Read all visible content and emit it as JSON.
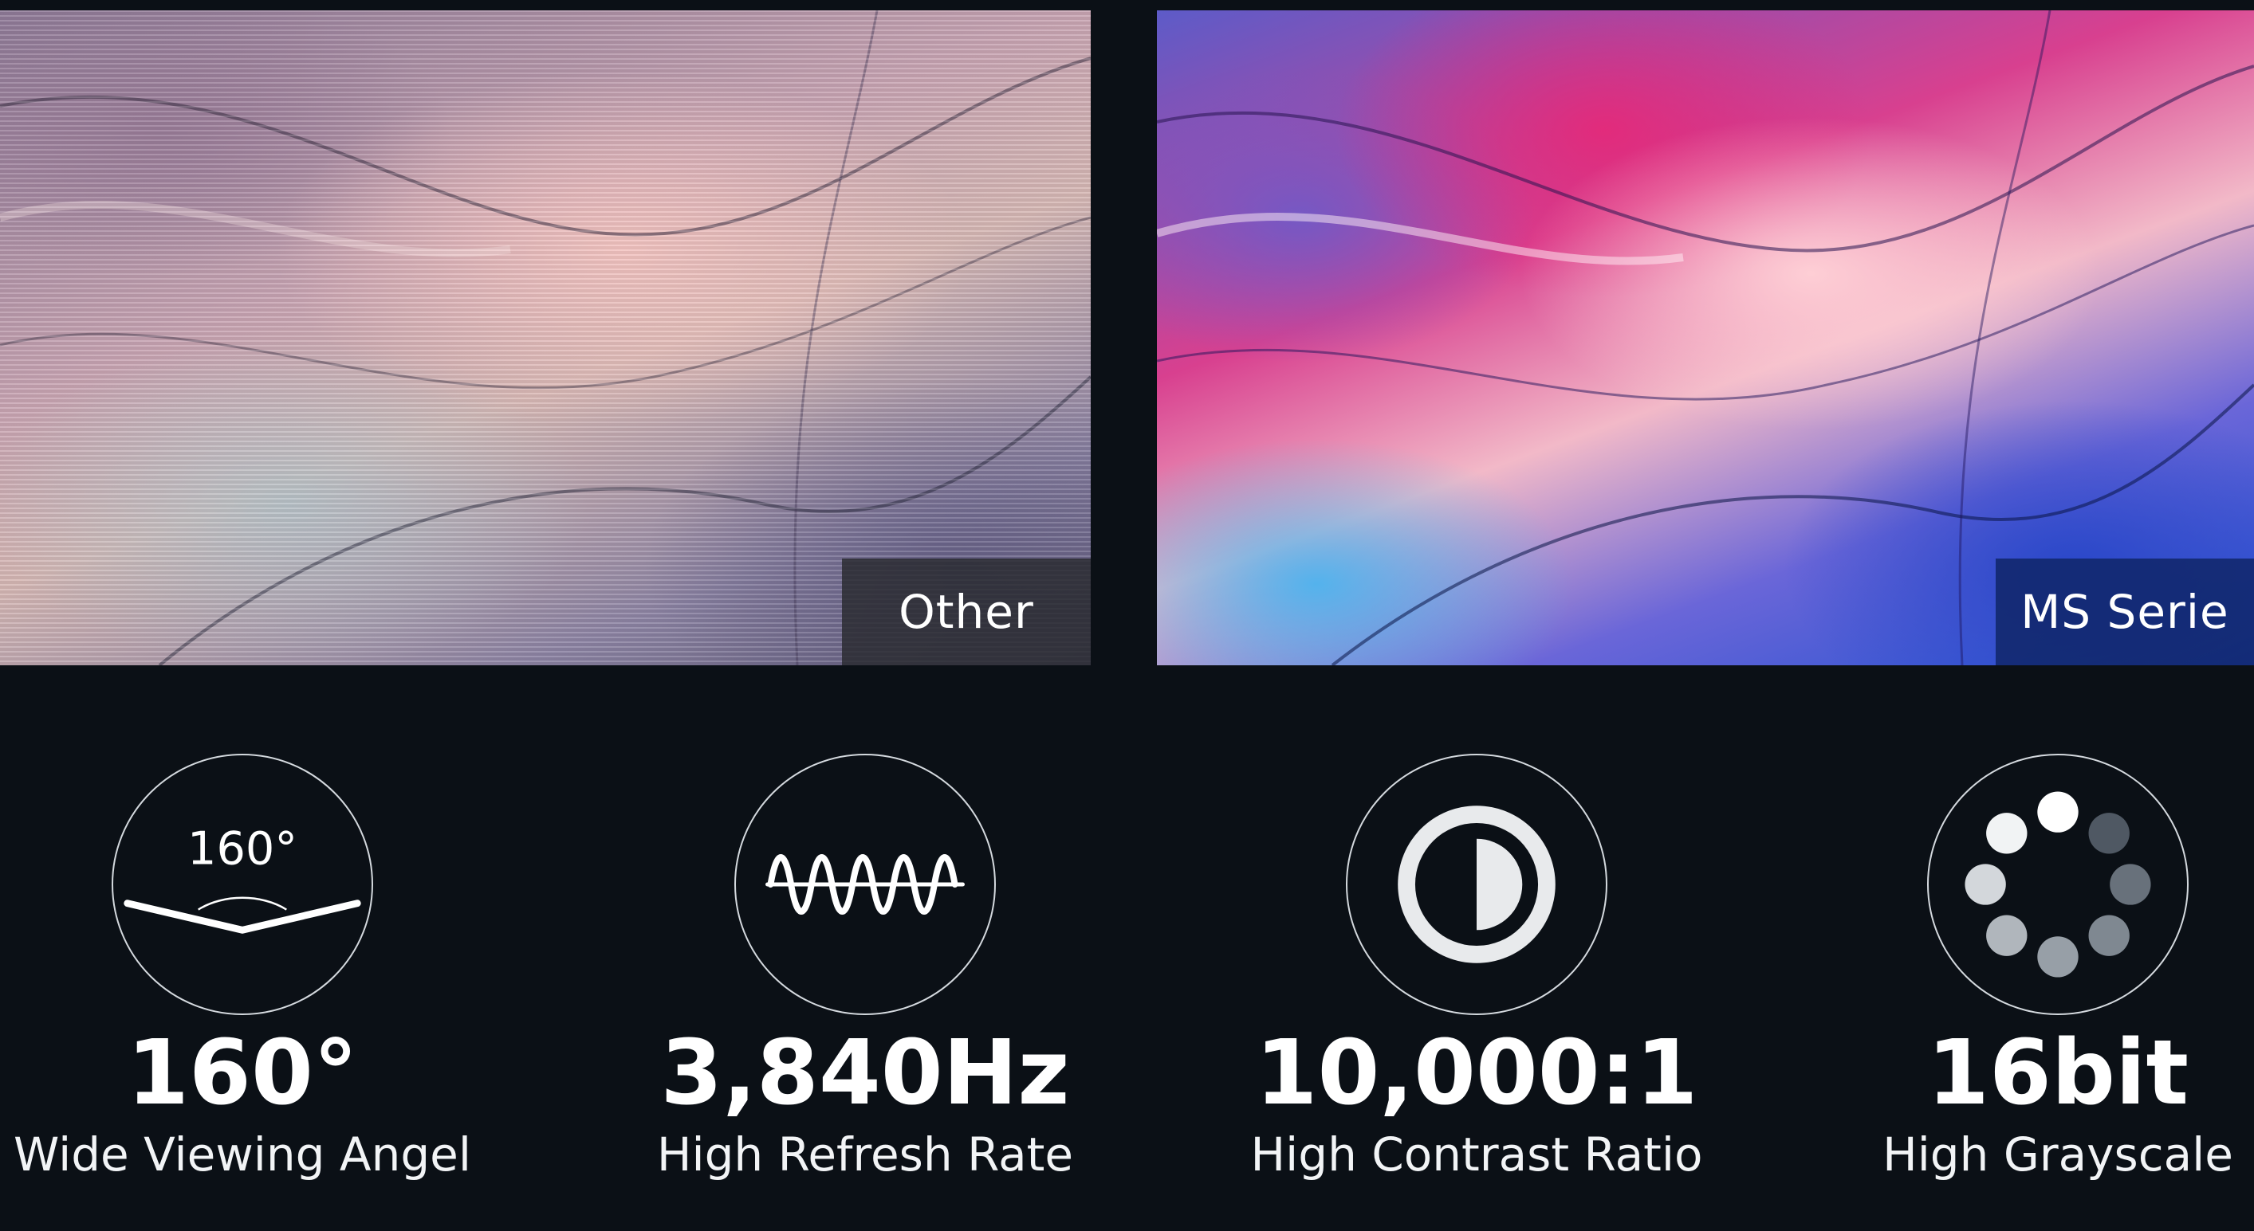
{
  "comparison": {
    "left_label": "Other",
    "right_label": "MS Serie"
  },
  "features": [
    {
      "icon": "viewing-angle-icon",
      "icon_text": "160°",
      "value": "160°",
      "caption": "Wide Viewing Angel"
    },
    {
      "icon": "refresh-wave-icon",
      "value": "3,840Hz",
      "caption": "High Refresh Rate"
    },
    {
      "icon": "contrast-icon",
      "value": "10,000:1",
      "caption": "High Contrast Ratio"
    },
    {
      "icon": "grayscale-dots-icon",
      "value": "16bit",
      "caption": "High Grayscale"
    }
  ],
  "colors": {
    "background": "#0b1016",
    "other_label_bg": "#2a2c30",
    "ms_label_bg": "#12286e",
    "icon_stroke": "#d4d9de"
  }
}
